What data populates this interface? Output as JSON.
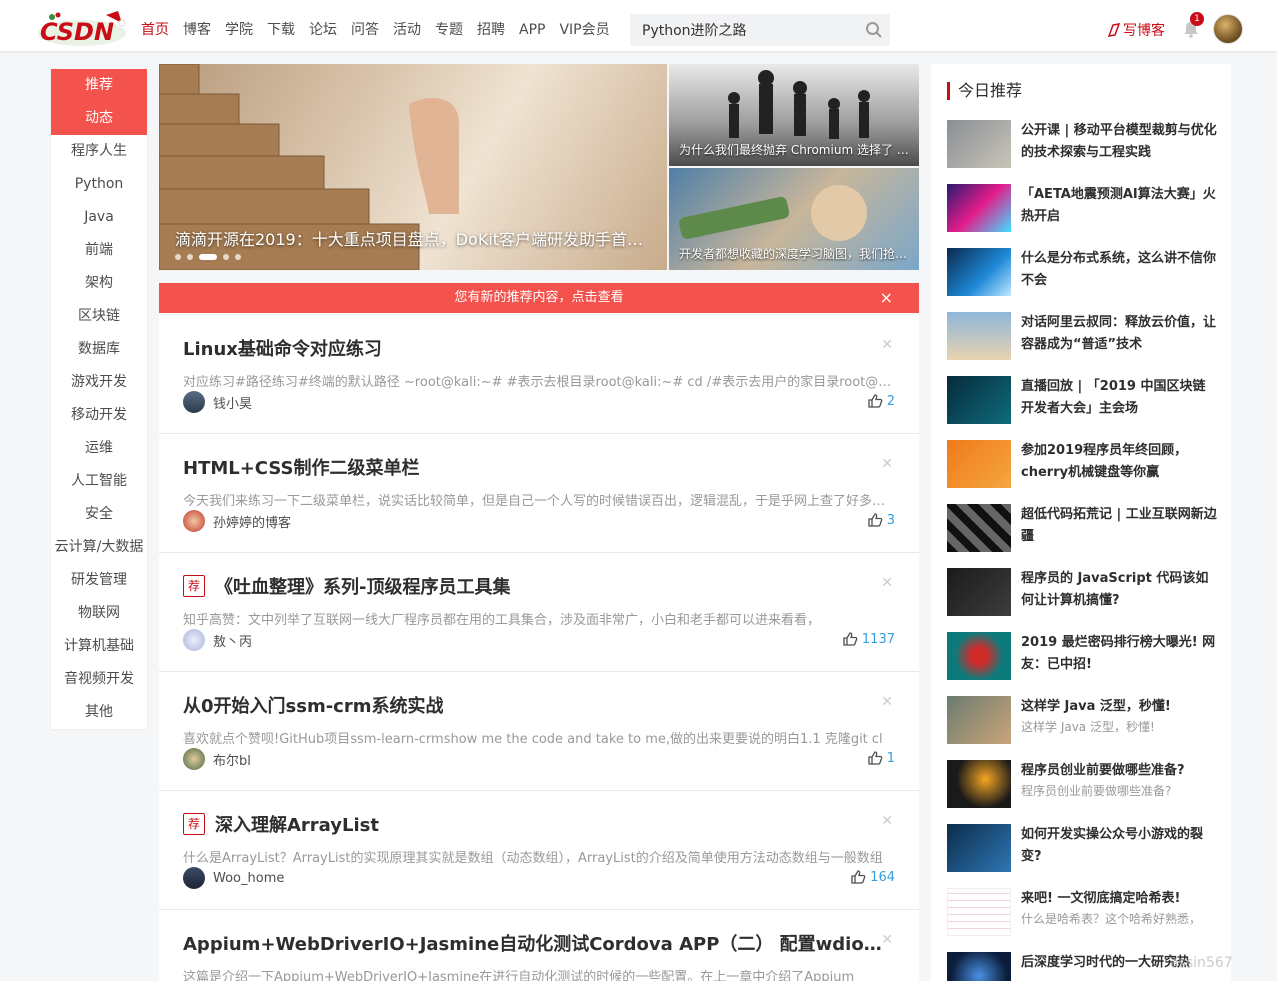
{
  "nav": {
    "items": [
      "首页",
      "博客",
      "学院",
      "下载",
      "论坛",
      "问答",
      "活动",
      "专题",
      "招聘",
      "APP",
      "VIP会员"
    ],
    "active_index": 0,
    "search_value": "Python进阶之路",
    "write_label": "写博客",
    "badge_count": "1",
    "accent_color": "#ca0c16"
  },
  "categories": [
    "推荐",
    "动态",
    "程序人生",
    "Python",
    "Java",
    "前端",
    "架构",
    "区块链",
    "数据库",
    "游戏开发",
    "移动开发",
    "运维",
    "人工智能",
    "安全",
    "云计算/大数据",
    "研发管理",
    "物联网",
    "计算机基础",
    "音视频开发",
    "其他"
  ],
  "carousel": {
    "main_title": "滴滴开源在2019：十大重点项目盘点，DoKit客户端研发助手首破…",
    "side_top": "为什么我们最终抛弃 Chromium 选择了 F…",
    "side_bottom": "开发者都想收藏的深度学习脑图，我们抢…"
  },
  "notice": {
    "text": "您有新的推荐内容，点击查看",
    "close": "×"
  },
  "articles": [
    {
      "title": "Linux基础命令对应练习",
      "recommended": false,
      "desc": "对应练习#路径练习#终端的默认路径 ~root@kali:~# #表示去根目录root@kali:~# cd /#表示去用户的家目录root@kali",
      "author": "钱小昊",
      "likes": "2"
    },
    {
      "title": "HTML+CSS制作二级菜单栏",
      "recommended": false,
      "desc": "今天我们来练习一下二级菜单栏，说实话比较简单，但是自己一个人写的时候错误百出，逻辑混乱，于是乎网上查了好多资料",
      "author": "孙婷婷的博客",
      "likes": "3"
    },
    {
      "title": "《吐血整理》系列-顶级程序员工具集",
      "recommended": true,
      "desc": "知乎高赞：文中列举了互联网一线大厂程序员都在用的工具集合，涉及面非常广，小白和老手都可以进来看看，",
      "author": "敖丶丙",
      "likes": "1137"
    },
    {
      "title": "从0开始入门ssm-crm系统实战",
      "recommended": false,
      "desc": "喜欢就点个赞呗!GitHub项目ssm-learn-crmshow me the code and take to me,做的出来更要说的明白1.1 克隆git cl",
      "author": "布尔bl",
      "likes": "1"
    },
    {
      "title": "深入理解ArrayList",
      "recommended": true,
      "desc": "什么是ArrayList？ArrayList的实现原理其实就是数组（动态数组），ArrayList的介绍及简单使用方法动态数组与一般数组",
      "author": "Woo_home",
      "likes": "164"
    },
    {
      "title": "Appium+WebDriverIO+Jasmine自动化测试Cordova APP（二） 配置wdio.conf.js(…",
      "recommended": false,
      "desc": "这篇是介绍一下Appium+WebDriverIO+Jasmine在进行自动化测试的时候的一些配置。在上一章中介绍了Appium",
      "author": "",
      "likes": ""
    }
  ],
  "tag_label": "荐",
  "right": {
    "heading": "今日推荐",
    "items": [
      {
        "title": "公开课 | 移动平台模型裁剪与优化的技术探索与工程实践",
        "sub": ""
      },
      {
        "title": "「AETA地震预测AI算法大赛」火热开启",
        "sub": ""
      },
      {
        "title": "什么是分布式系统，这么讲不信你不会",
        "sub": ""
      },
      {
        "title": "对话阿里云叔同：释放云价值，让容器成为“普适”技术",
        "sub": ""
      },
      {
        "title": "直播回放 | 「2019 中国区块链开发者大会」主会场",
        "sub": ""
      },
      {
        "title": "参加2019程序员年终回顾，cherry机械键盘等你赢",
        "sub": ""
      },
      {
        "title": "超低代码拓荒记 | 工业互联网新边疆",
        "sub": ""
      },
      {
        "title": "程序员的 JavaScript 代码该如何让计算机搞懂?",
        "sub": ""
      },
      {
        "title": "2019 最烂密码排行榜大曝光! 网友：已中招!",
        "sub": ""
      },
      {
        "title": "这样学 Java 泛型，秒懂!",
        "sub": "这样学 Java 泛型，秒懂!"
      },
      {
        "title": "程序员创业前要做哪些准备?",
        "sub": "程序员创业前要做哪些准备?"
      },
      {
        "title": "如何开发实操公众号小游戏的裂变?",
        "sub": ""
      },
      {
        "title": "来吧! 一文彻底搞定哈希表!",
        "sub": "什么是哈希表？这个哈希好熟悉，"
      },
      {
        "title": "后深度学习时代的一大研究热",
        "sub": ""
      }
    ]
  },
  "watermark": "assin567"
}
